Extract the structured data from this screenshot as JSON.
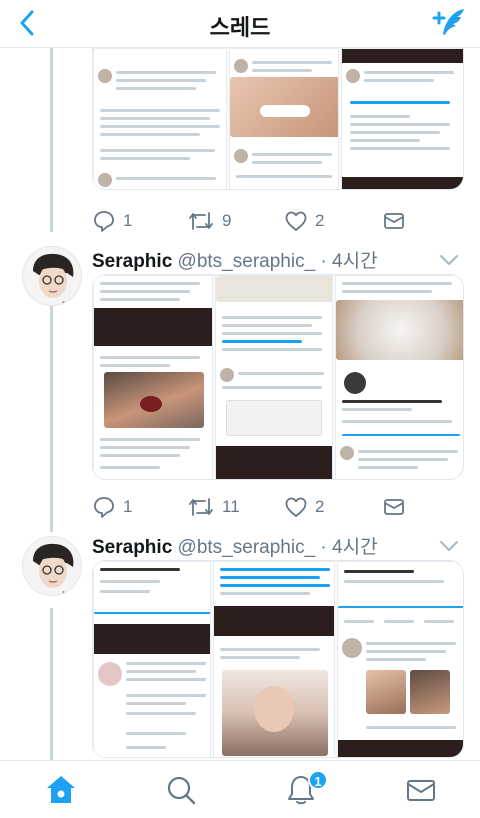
{
  "header": {
    "title": "스레드",
    "back_icon": "chevron-left-icon",
    "compose_icon": "compose-feather-icon",
    "accent": "#1da1f2"
  },
  "tweets": [
    {
      "actions": {
        "reply": "1",
        "retweet": "9",
        "like": "2"
      }
    },
    {
      "name": "Seraphic",
      "handle": "@bts_seraphic_",
      "time": "· 4시간",
      "actions": {
        "reply": "1",
        "retweet": "11",
        "like": "2"
      }
    },
    {
      "name": "Seraphic",
      "handle": "@bts_seraphic_",
      "time": "· 4시간"
    }
  ],
  "tabbar": {
    "items": [
      "home-icon",
      "search-icon",
      "notifications-icon",
      "messages-icon"
    ],
    "notification_count": "1"
  }
}
